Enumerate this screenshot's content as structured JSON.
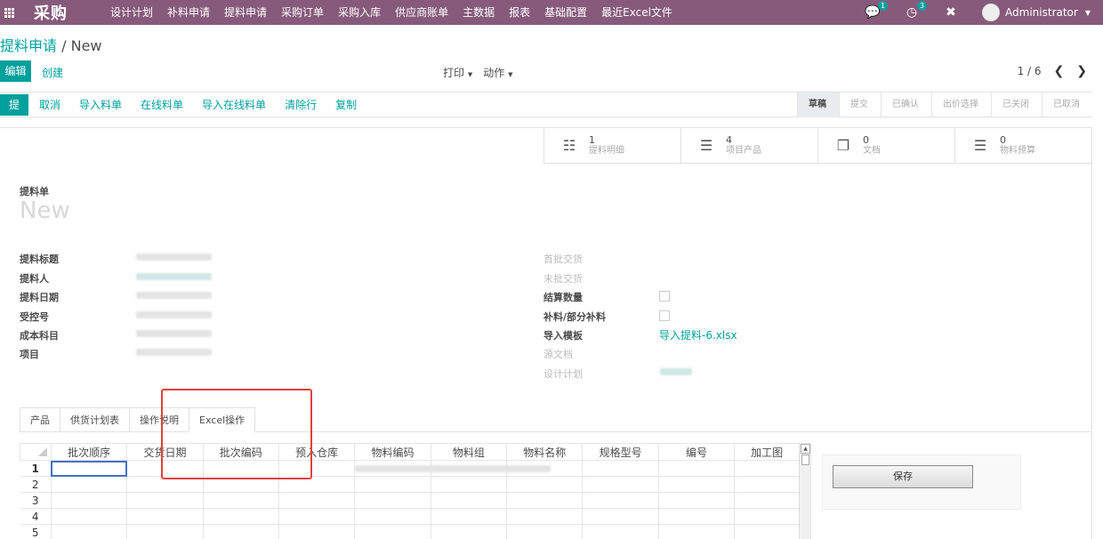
{
  "nav": {
    "brand": "采购",
    "menu": [
      "设计计划",
      "补料申请",
      "提料申请",
      "采购订单",
      "采购入库",
      "供应商账单",
      "主数据",
      "报表",
      "基础配置",
      "最近Excel文件"
    ],
    "messages_count": "1",
    "activities_count": "3",
    "user": "Administrator"
  },
  "breadcrumb": {
    "parent": "提料申请",
    "sep": "/",
    "current": "New"
  },
  "buttons": {
    "edit": "编辑",
    "create": "创建",
    "print": "打印",
    "action": "动作"
  },
  "pager": {
    "value": "1 / 6"
  },
  "statusbar": {
    "submit": "提交",
    "actions": [
      "取消",
      "导入料单",
      "在线料单",
      "导入在线料单",
      "清除行",
      "复制"
    ],
    "stages": [
      "草稿",
      "提交",
      "已确认",
      "出价选择",
      "已关闭",
      "已取消"
    ],
    "active_stage": "草稿"
  },
  "smart_buttons": [
    {
      "icon": "sitemap-icon",
      "count": "1",
      "label": "提料明细"
    },
    {
      "icon": "list-icon",
      "count": "4",
      "label": "项目产品"
    },
    {
      "icon": "files-icon",
      "count": "0",
      "label": "文档"
    },
    {
      "icon": "list-icon",
      "count": "0",
      "label": "物料预算"
    }
  ],
  "form": {
    "title_label": "提料单",
    "title": "New",
    "left_fields": [
      "提料标题",
      "提料人",
      "提料日期",
      "受控号",
      "成本科目",
      "项目"
    ],
    "right_fields": [
      "首批交货",
      "末批交货",
      "结算数量",
      "补料/部分补料",
      "导入模板",
      "源文档",
      "设计计划"
    ],
    "import_template_value": "导入提料-6.xlsx"
  },
  "tabs": [
    "产品",
    "供货计划表",
    "操作说明",
    "Excel操作"
  ],
  "active_tab": "Excel操作",
  "spreadsheet": {
    "columns": [
      "批次顺序",
      "交货日期",
      "批次编码",
      "预入仓库",
      "物料编码",
      "物料组",
      "物料名称",
      "规格型号",
      "编号",
      "加工图"
    ],
    "rows": [
      "1",
      "2",
      "3",
      "4",
      "5"
    ],
    "selected_row": "1"
  },
  "save_button": "保存",
  "colors": {
    "nav": "#875a7b",
    "accent": "#00a09d",
    "highlight": "#e0413a"
  }
}
